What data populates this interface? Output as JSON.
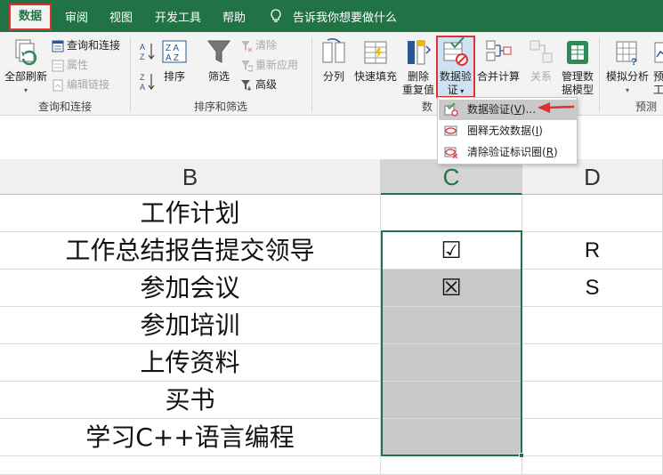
{
  "tabs": {
    "data": "数据",
    "review": "审阅",
    "view": "视图",
    "developer": "开发工具",
    "help": "帮助",
    "tell_me": "告诉我你想要做什么"
  },
  "ribbon": {
    "queries": {
      "refresh_all": "全部刷新",
      "queries_connections": "查询和连接",
      "properties": "属性",
      "edit_links": "编辑链接",
      "label": "查询和连接"
    },
    "sort_filter": {
      "sort": "排序",
      "filter": "筛选",
      "clear": "清除",
      "reapply": "重新应用",
      "advanced": "高级",
      "label": "排序和筛选"
    },
    "data_tools": {
      "split": "分列",
      "flash_fill": "快速填充",
      "remove_dup_1": "删除",
      "remove_dup_2": "重复值",
      "validation_1": "数据验",
      "validation_2": "证",
      "consolidate": "合并计算",
      "relationships": "关系",
      "manage_model_1": "管理数",
      "manage_model_2": "据模型",
      "label_partial": "数"
    },
    "forecast": {
      "what_if": "模拟分析",
      "forecast_sheet_1": "预",
      "forecast_sheet_2": "工",
      "label": "预测"
    }
  },
  "validation_menu": {
    "items": [
      {
        "label": "数据验证(",
        "key": "V",
        "suffix": ")..."
      },
      {
        "label": "圈释无效数据(",
        "key": "I",
        "suffix": ")"
      },
      {
        "label": "清除验证标识圈(",
        "key": "R",
        "suffix": ")"
      }
    ]
  },
  "sheet": {
    "columns": [
      "B",
      "C",
      "D"
    ],
    "rows": [
      {
        "b": "工作计划",
        "c": "",
        "d": ""
      },
      {
        "b": "工作总结报告提交领导",
        "c": "☑",
        "d": "R"
      },
      {
        "b": "参加会议",
        "c": "☒",
        "d": "S"
      },
      {
        "b": "参加培训",
        "c": "",
        "d": ""
      },
      {
        "b": "上传资料",
        "c": "",
        "d": ""
      },
      {
        "b": "买书",
        "c": "",
        "d": ""
      },
      {
        "b": "学习C++语言编程",
        "c": "",
        "d": ""
      }
    ]
  },
  "colors": {
    "excel_green": "#217346",
    "highlight_red": "#e03030",
    "selection_shade": "#c8c8c8"
  }
}
